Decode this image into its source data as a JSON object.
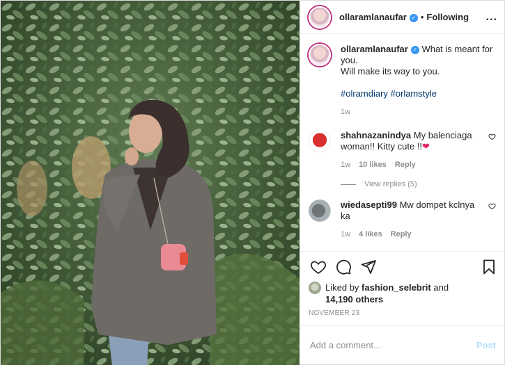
{
  "header": {
    "username": "ollaramlanaufar",
    "verified_icon": "verified-badge-icon",
    "separator": "•",
    "follow_label": "Following",
    "more_label": "..."
  },
  "caption": {
    "username": "ollaramlanaufar",
    "text_line1": "What is meant for you.",
    "text_line2": "Will make its way to you.",
    "hashtags": "#olramdiary #orlamstyle",
    "time": "1w"
  },
  "comments": [
    {
      "username": "shahnazanindya",
      "text": "My balenciaga woman!! Kitty cute !!",
      "time": "1w",
      "likes": "10 likes",
      "reply": "Reply"
    },
    {
      "username": "wiedasepti99",
      "text": "Mw dompet kclnya ka",
      "time": "1w",
      "likes": "4 likes",
      "reply": "Reply"
    }
  ],
  "view_replies": "View replies (5)",
  "likes": {
    "prefix": "Liked by",
    "user": "fashion_selebrit",
    "and": "and",
    "others": "14,190 others"
  },
  "date": "NOVEMBER 23",
  "add_comment": {
    "placeholder": "Add a comment...",
    "post_label": "Post"
  },
  "colors": {
    "link": "#00376b",
    "verified": "#3897f0",
    "post_disabled": "#b2dffc"
  }
}
